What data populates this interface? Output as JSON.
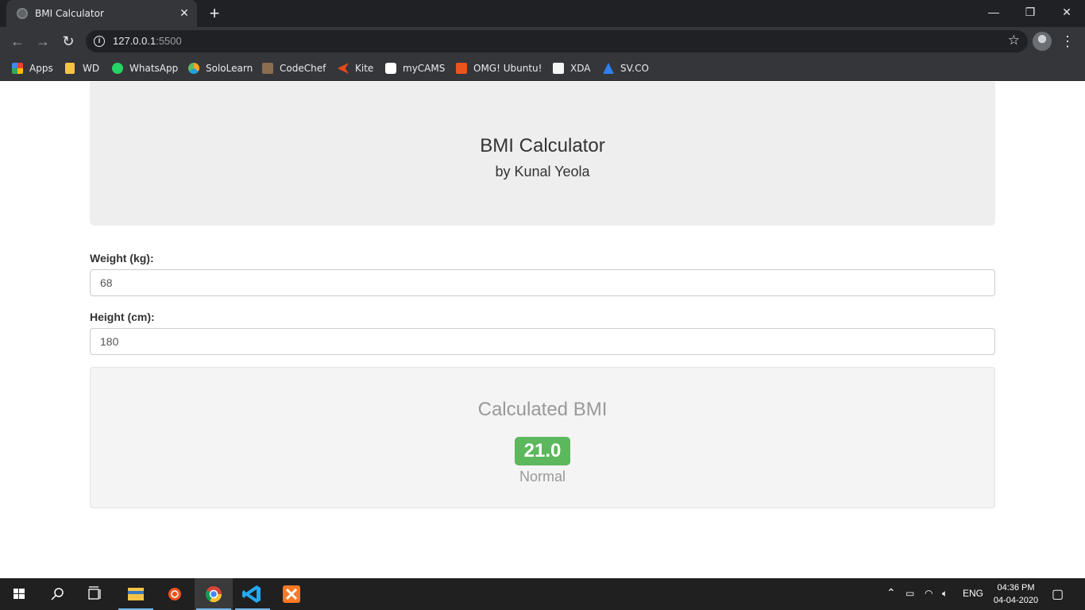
{
  "browser": {
    "tab": {
      "title": "BMI Calculator"
    },
    "address": {
      "host": "127.0.0.1",
      "port": ":5500"
    },
    "bookmarks": [
      {
        "label": "Apps",
        "icon": "apps-grid-icon",
        "color": "#ea4335"
      },
      {
        "label": "WD",
        "icon": "folder-icon",
        "color": "#f6c445"
      },
      {
        "label": "WhatsApp",
        "icon": "whatsapp-icon",
        "color": "#25d366"
      },
      {
        "label": "SoloLearn",
        "icon": "sololearn-icon",
        "color": "#f5a623"
      },
      {
        "label": "CodeChef",
        "icon": "codechef-icon",
        "color": "#8b6d4f"
      },
      {
        "label": "Kite",
        "icon": "kite-icon",
        "color": "#e64a19"
      },
      {
        "label": "myCAMS",
        "icon": "mycams-icon",
        "color": "#ffffff"
      },
      {
        "label": "OMG! Ubuntu!",
        "icon": "omg-ubuntu-icon",
        "color": "#e95420"
      },
      {
        "label": "XDA",
        "icon": "xda-icon",
        "color": "#f5f5f5"
      },
      {
        "label": "SV.CO",
        "icon": "svco-icon",
        "color": "#2f80ed"
      }
    ]
  },
  "app": {
    "title": "BMI Calculator",
    "subtitle": "by Kunal Yeola",
    "weight": {
      "label": "Weight (kg):",
      "value": "68"
    },
    "height": {
      "label": "Height (cm):",
      "value": "180"
    },
    "result": {
      "title": "Calculated BMI",
      "bmi": "21.0",
      "category": "Normal",
      "badge_color": "#5cb85c"
    }
  },
  "taskbar": {
    "language": "ENG",
    "time": "04:36 PM",
    "date": "04-04-2020"
  }
}
